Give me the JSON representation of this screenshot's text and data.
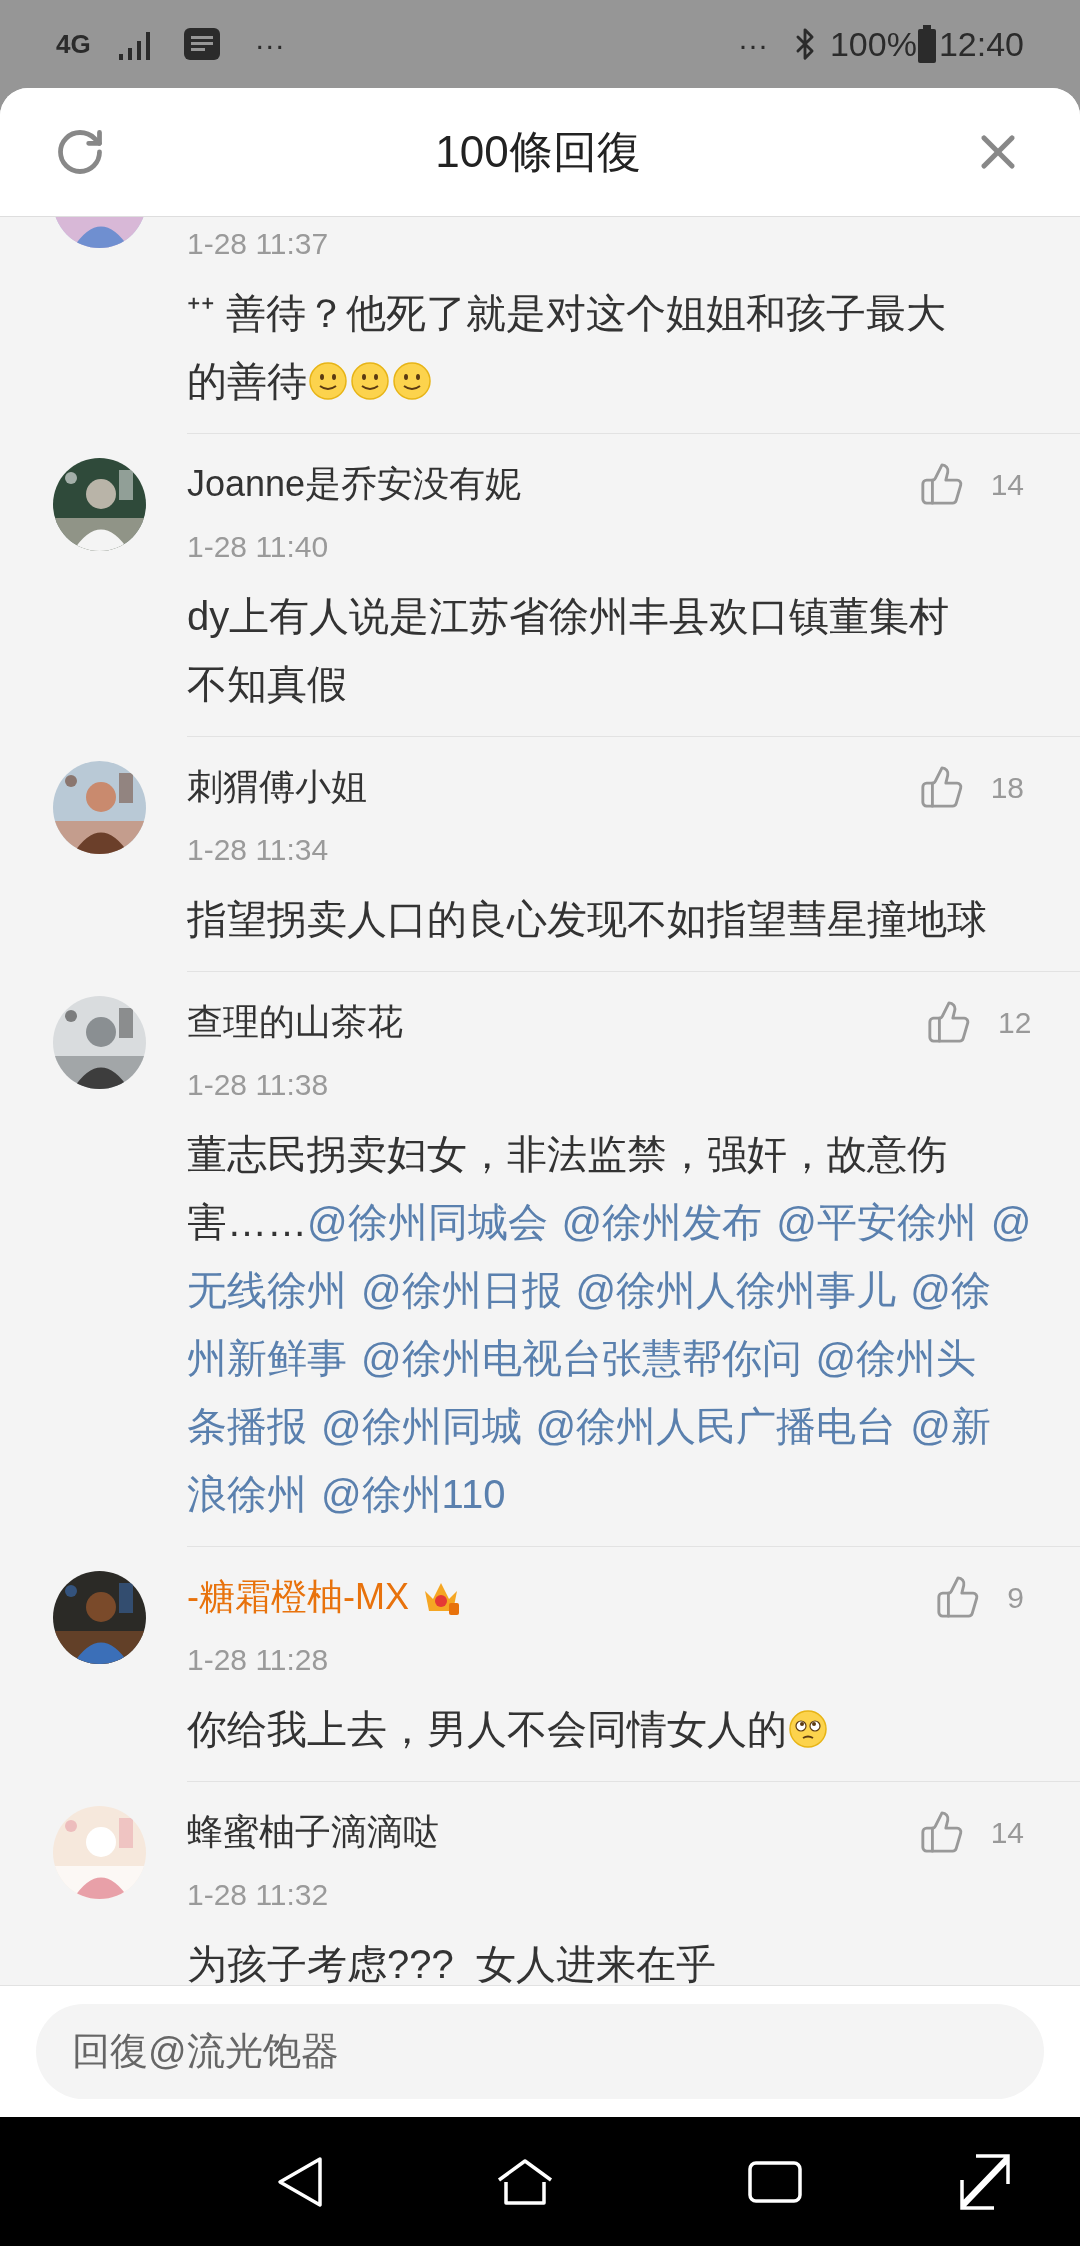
{
  "status_bar": {
    "network": "4G",
    "more_left": "···",
    "more_right": "···",
    "battery": "100%",
    "time": "12:40"
  },
  "header": {
    "title": "100條回復"
  },
  "comments": [
    {
      "time": "1-28 11:37",
      "lines": [
        [
          {
            "kind": "text",
            "text": "⁺⁺ 善待？他死了就是对这个姐姐和孩子最大"
          }
        ],
        [
          {
            "kind": "text",
            "text": "的善待"
          },
          {
            "kind": "smile"
          },
          {
            "kind": "smile"
          },
          {
            "kind": "smile"
          }
        ]
      ]
    },
    {
      "name": "Joanne是乔安没有妮",
      "vip": false,
      "likes": "14",
      "time": "1-28 11:40",
      "lines": [
        [
          {
            "kind": "text",
            "text": "dy上有人说是江苏省徐州丰县欢口镇董集村"
          }
        ],
        [
          {
            "kind": "text",
            "text": "不知真假"
          }
        ]
      ]
    },
    {
      "name": "刺猬傅小姐",
      "vip": false,
      "likes": "18",
      "time": "1-28 11:34",
      "lines": [
        [
          {
            "kind": "text",
            "text": "指望拐卖人口的良心发现不如指望彗星撞地球"
          }
        ]
      ]
    },
    {
      "name": "查理的山茶花",
      "vip": false,
      "likes": "12",
      "time": "1-28 11:38",
      "lines": [
        [
          {
            "kind": "text",
            "text": "董志民拐卖妇女，非法监禁，强奸，故意伤"
          }
        ],
        [
          {
            "kind": "text",
            "text": "害……"
          },
          {
            "kind": "mention",
            "text": "@徐州同城会"
          },
          {
            "kind": "mention",
            "text": "@徐州发布"
          },
          {
            "kind": "mention",
            "text": "@平安徐州"
          },
          {
            "kind": "mention",
            "text": "@"
          }
        ],
        [
          {
            "kind": "mention",
            "text": "无线徐州"
          },
          {
            "kind": "mention",
            "text": "@徐州日报"
          },
          {
            "kind": "mention",
            "text": "@徐州人徐州事儿"
          },
          {
            "kind": "mention",
            "text": "@徐"
          }
        ],
        [
          {
            "kind": "mention",
            "text": "州新鲜事"
          },
          {
            "kind": "mention",
            "text": "@徐州电视台张慧帮你问"
          },
          {
            "kind": "mention",
            "text": "@徐州头"
          }
        ],
        [
          {
            "kind": "mention",
            "text": "条播报"
          },
          {
            "kind": "mention",
            "text": "@徐州同城"
          },
          {
            "kind": "mention",
            "text": "@徐州人民广播电台"
          },
          {
            "kind": "mention",
            "text": "@新"
          }
        ],
        [
          {
            "kind": "mention",
            "text": "浪徐州"
          },
          {
            "kind": "mention",
            "text": "@徐州110"
          }
        ]
      ]
    },
    {
      "name": "-糖霜橙柚-MX",
      "vip": true,
      "likes": "9",
      "time": "1-28 11:28",
      "lines": [
        [
          {
            "kind": "text",
            "text": "你给我上去，男人不会同情女人的"
          },
          {
            "kind": "spiral"
          }
        ]
      ]
    },
    {
      "name": "蜂蜜柚子滴滴哒",
      "vip": false,
      "likes": "14",
      "time": "1-28 11:32",
      "lines": [
        [
          {
            "kind": "text",
            "text": "为孩子考虑???  女人进来在乎"
          }
        ]
      ]
    }
  ],
  "reply_field": {
    "placeholder": "回復@流光饱器"
  }
}
